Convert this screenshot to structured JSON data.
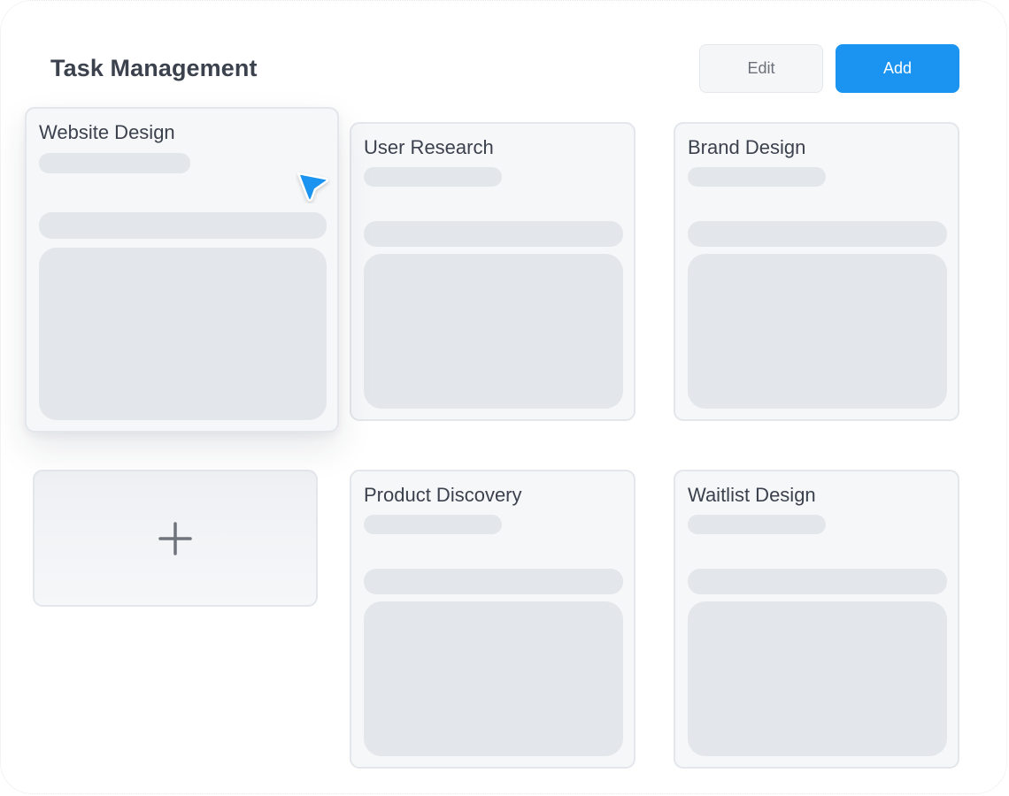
{
  "header": {
    "title": "Task Management",
    "edit_label": "Edit",
    "add_label": "Add"
  },
  "colors": {
    "accent": "#1a94f0",
    "title_text": "#3b414d",
    "card_bg": "#f6f7f9",
    "placeholder": "#e3e6ea"
  },
  "cards": [
    {
      "title": "Website Design",
      "state": "dragging"
    },
    {
      "title": "User Research"
    },
    {
      "title": "Brand Design"
    },
    {
      "title": "Product Discovery"
    },
    {
      "title": "Waitlist Design"
    }
  ],
  "add_card": {
    "icon": "plus-icon"
  },
  "cursor": {
    "icon": "pointer-cursor-icon"
  }
}
